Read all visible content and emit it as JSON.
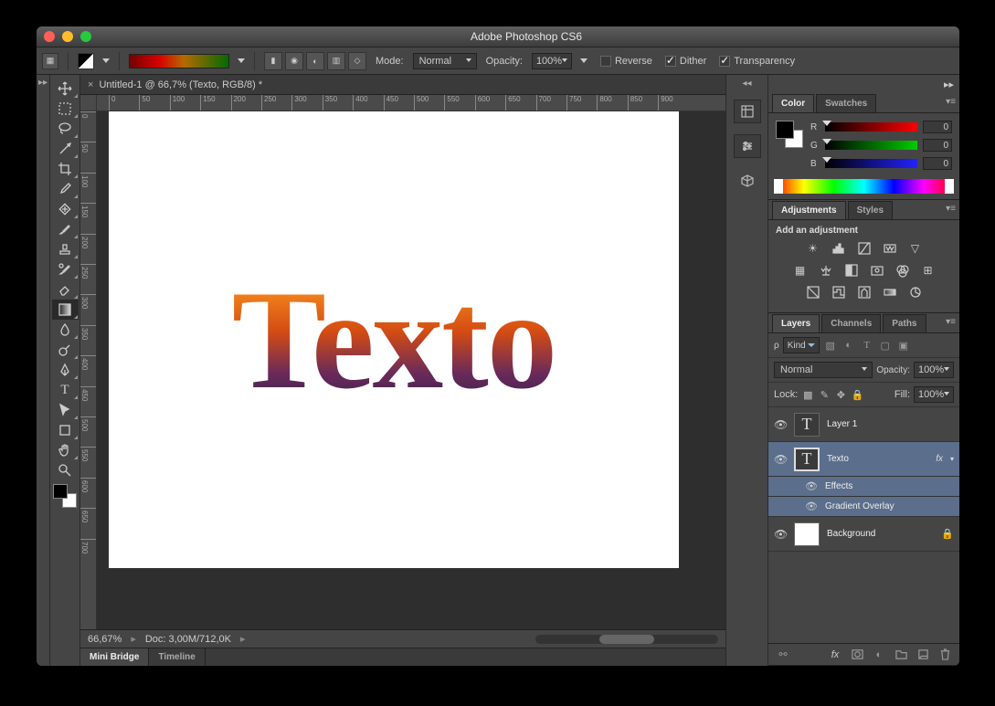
{
  "title": "Adobe Photoshop CS6",
  "options_bar": {
    "mode_label": "Mode:",
    "mode_value": "Normal",
    "opacity_label": "Opacity:",
    "opacity_value": "100%",
    "reverse_label": "Reverse",
    "dither_label": "Dither",
    "transparency_label": "Transparency"
  },
  "document": {
    "tab_title": "Untitled-1 @ 66,7% (Texto, RGB/8) *",
    "zoom": "66,67%",
    "info": "Doc: 3,00M/712,0K",
    "canvas_text": "Texto"
  },
  "ruler_marks_h": [
    "0",
    "50",
    "100",
    "150",
    "200",
    "250",
    "300",
    "350",
    "400",
    "450",
    "500",
    "550",
    "600",
    "650",
    "700",
    "750",
    "800",
    "850",
    "900"
  ],
  "ruler_marks_v": [
    "0",
    "50",
    "100",
    "150",
    "200",
    "250",
    "300",
    "350",
    "400",
    "450",
    "500",
    "550",
    "600",
    "650",
    "700"
  ],
  "bottom_tabs": {
    "mini_bridge": "Mini Bridge",
    "timeline": "Timeline"
  },
  "panels": {
    "color": {
      "tab1": "Color",
      "tab2": "Swatches",
      "r": "0",
      "g": "0",
      "b": "0",
      "r_label": "R",
      "g_label": "G",
      "b_label": "B"
    },
    "adjustments": {
      "tab1": "Adjustments",
      "tab2": "Styles",
      "header": "Add an adjustment"
    },
    "layers": {
      "tab1": "Layers",
      "tab2": "Channels",
      "tab3": "Paths",
      "kind": "Kind",
      "blend_mode": "Normal",
      "opacity_label": "Opacity:",
      "opacity_value": "100%",
      "lock_label": "Lock:",
      "fill_label": "Fill:",
      "fill_value": "100%",
      "items": [
        {
          "name": "Layer 1",
          "type": "text"
        },
        {
          "name": "Texto",
          "type": "text",
          "selected": true,
          "fx": true
        },
        {
          "name": "Effects",
          "sub": true
        },
        {
          "name": "Gradient Overlay",
          "sub": true
        },
        {
          "name": "Background",
          "type": "bg",
          "locked": true
        }
      ],
      "effects_label": "Effects",
      "gradient_overlay_label": "Gradient Overlay"
    }
  }
}
